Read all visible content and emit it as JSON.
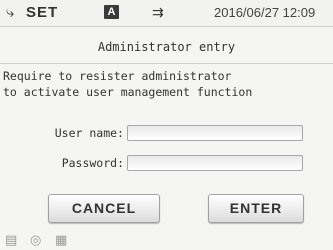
{
  "status_bar": {
    "set_icon": "antenna-icon",
    "set_label": "SET",
    "a_icon_label": "A",
    "usb_icon": "usb-icon",
    "datetime": "2016/06/27 12:09"
  },
  "dialog": {
    "title": "Administrator entry",
    "message": "Require to resister administrator\nto activate user management function",
    "username_label": "User name:",
    "username_value": "",
    "password_label": "Password:",
    "password_value": ""
  },
  "buttons": {
    "cancel_label": "CANCEL",
    "enter_label": "ENTER"
  },
  "bottom_bar": {
    "icons": [
      "document-icon",
      "globe-icon",
      "grid-icon"
    ]
  }
}
